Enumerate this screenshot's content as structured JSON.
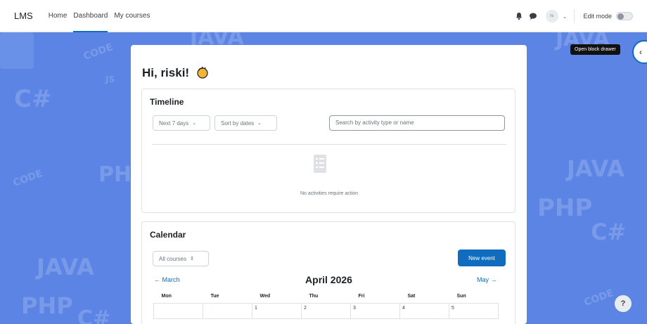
{
  "navbar": {
    "brand": "LMS",
    "links": [
      {
        "label": "Home",
        "active": false
      },
      {
        "label": "Dashboard",
        "active": true
      },
      {
        "label": "My courses",
        "active": false
      }
    ],
    "notification_icon": "bell-icon",
    "messages_icon": "chat-bubble-icon",
    "user_initials": "rs",
    "edit_mode_label": "Edit mode",
    "edit_mode_on": false
  },
  "drawer": {
    "tooltip": "Open block drawer",
    "button_icon": "chevron-left-icon"
  },
  "help": {
    "label": "?"
  },
  "background": {
    "decor_texts": [
      "JAVA",
      "PHP",
      "C#",
      "CODE",
      "JS",
      "JAVA",
      "PHP",
      "C#",
      "PHP",
      "CODE",
      "JAVA",
      "C#",
      "JAVA",
      "PHP",
      "CODE"
    ]
  },
  "main": {
    "greeting": "Hi, riski!",
    "greeting_icon": "waving-hand-icon",
    "timeline": {
      "title": "Timeline",
      "filter_label": "Next 7 days",
      "sort_label": "Sort by dates",
      "search_placeholder": "Search by activity type or name",
      "empty_icon": "empty-list-icon",
      "empty_text": "No activities require action"
    },
    "calendar": {
      "title": "Calendar",
      "course_filter": "All courses",
      "new_event_label": "New event",
      "prev_label": "March",
      "next_label": "May",
      "month_label": "April 2026",
      "weekdays": [
        "Mon",
        "Tue",
        "Wed",
        "Thu",
        "Fri",
        "Sat",
        "Sun"
      ],
      "first_week": [
        "",
        "",
        "1",
        "2",
        "3",
        "4",
        "5"
      ]
    }
  },
  "colors": {
    "background": "#5c84e4",
    "primary": "#0f6cbf",
    "panel": "#ffffff"
  }
}
